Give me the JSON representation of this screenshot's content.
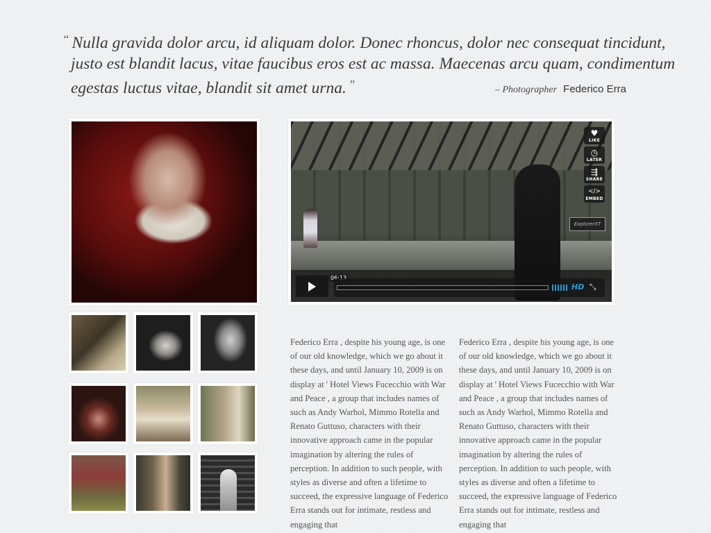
{
  "quote": {
    "open_mark": "“",
    "close_mark": "”",
    "lines": [
      "Nulla gravida dolor arcu, id aliquam dolor. Donec rhoncus, dolor nec consequat tincidunt,",
      "justo est blandit lacus, vitae faucibus eros est ac massa. Maecenas arcu quam, condimentum",
      "egestas luctus vitae, blandit sit amet urna."
    ],
    "attribution_role": "– Photographer",
    "attribution_name": "Federico Erra"
  },
  "video": {
    "time": "06:13",
    "hd_label": "HD",
    "fullscreen_icon": "fullscreen-icon",
    "play_icon": "play-icon",
    "actions": [
      {
        "label": "LIKE",
        "icon": "heart-icon",
        "glyph": "♥"
      },
      {
        "label": "LATER",
        "icon": "clock-icon",
        "glyph": "◷"
      },
      {
        "label": "SHARE",
        "icon": "share-icon",
        "glyph": "⇶"
      },
      {
        "label": "EMBED",
        "icon": "code-icon",
        "glyph": "</>"
      }
    ],
    "accent_color": "#2a9ad6"
  },
  "body_text": {
    "column_1": "Federico Erra , despite his young age, is one of our old knowledge, which we go about it these days, and until January 10, 2009 is on display at ' Hotel Views Fucecchio with War and Peace , a group that includes names of such as Andy Warhol, Mimmo Rotella and Renato Guttuso, characters with their innovative approach came in the popular imagination by altering the rules of perception. In addition to such people, with styles as diverse and often a lifetime to succeed, the expressive language of Federico Erra stands out for intimate, restless and engaging that",
    "column_2": "Federico Erra , despite his young age, is one of our old knowledge, which we go about it these days, and until January 10, 2009 is on display at ' Hotel Views Fucecchio with War and Peace , a group that includes names of such as Andy Warhol, Mimmo Rotella and Renato Guttuso, characters with their innovative approach came in the popular imagination by altering the rules of perception. In addition to such people, with styles as diverse and often a lifetime to succeed, the expressive language of Federico Erra stands out for intimate, restless and engaging that"
  }
}
